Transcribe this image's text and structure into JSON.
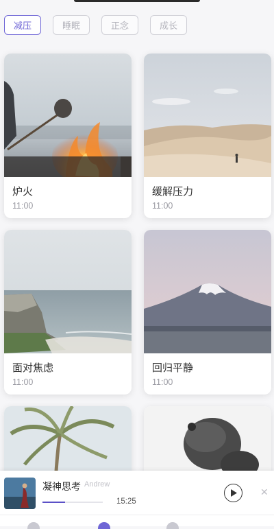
{
  "tabs": [
    {
      "label": "减压",
      "active": true
    },
    {
      "label": "睡眠",
      "active": false
    },
    {
      "label": "正念",
      "active": false
    },
    {
      "label": "成长",
      "active": false
    }
  ],
  "cards": [
    {
      "title": "炉火",
      "time": "11:00"
    },
    {
      "title": "缓解压力",
      "time": "11:00"
    },
    {
      "title": "面对焦虑",
      "time": "11:00"
    },
    {
      "title": "回归平静",
      "time": "11:00"
    },
    {
      "title": "",
      "time": ""
    },
    {
      "title": "",
      "time": ""
    }
  ],
  "player": {
    "title": "凝神思考",
    "artist": "Andrew",
    "time": "15:25",
    "progress": 0.38,
    "play_icon": "play-icon",
    "close_icon": "close-icon"
  },
  "colors": {
    "accent": "#6f66d6",
    "background": "#f6f6f8"
  }
}
